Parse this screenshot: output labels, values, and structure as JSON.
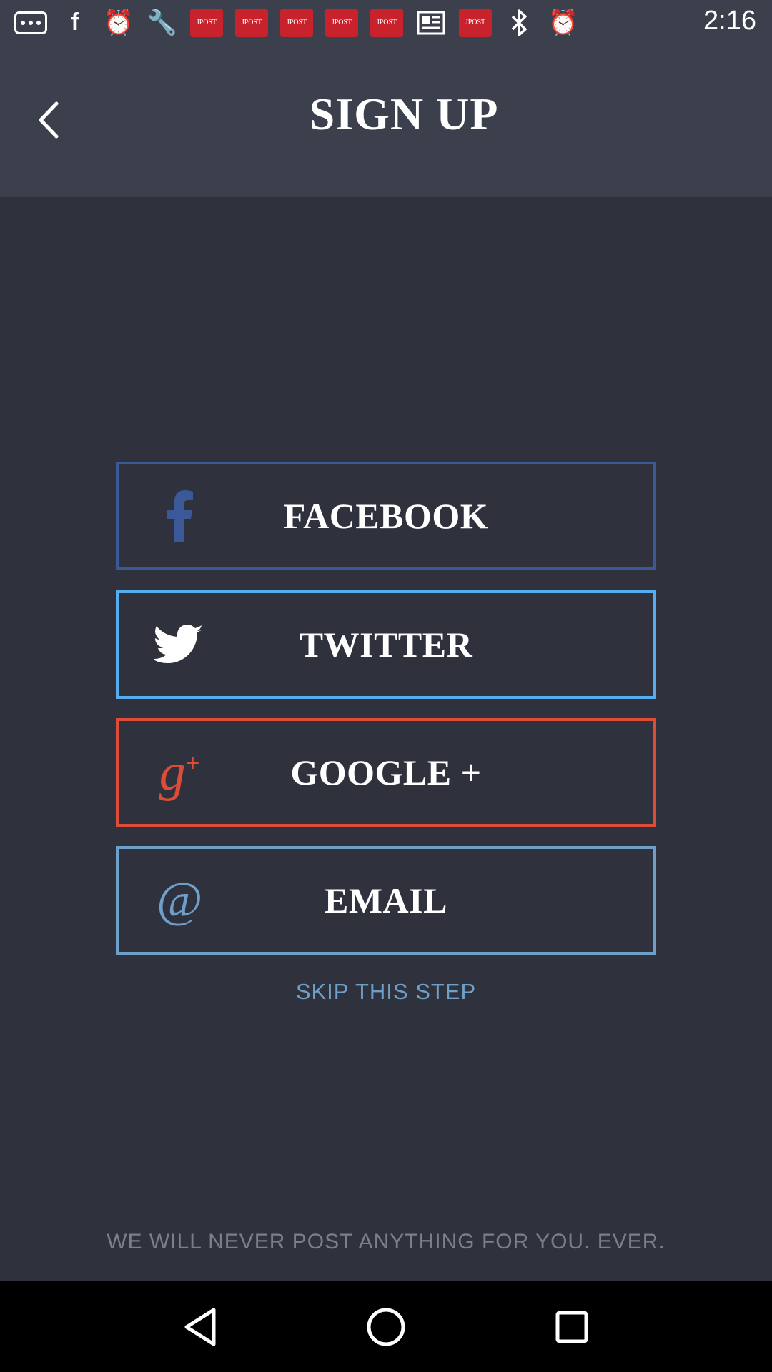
{
  "status_bar": {
    "time": "2:16",
    "jpost_badge": "JPOST",
    "icons": [
      "more-icon",
      "facebook-icon",
      "alarm-icon",
      "wrench-icon",
      "jpost-icon",
      "jpost-icon",
      "jpost-icon",
      "jpost-icon",
      "jpost-icon",
      "news-icon",
      "jpost-icon",
      "bluetooth-icon",
      "alarm-icon"
    ]
  },
  "header": {
    "title": "SIGN UP",
    "back_icon": "chevron-left-icon"
  },
  "buttons": [
    {
      "label": "FACEBOOK",
      "icon": "facebook-icon",
      "color": "#3b5998"
    },
    {
      "label": "TWITTER",
      "icon": "twitter-icon",
      "color": "#55acee"
    },
    {
      "label": "GOOGLE +",
      "icon": "google-plus-icon",
      "color": "#dd4b39"
    },
    {
      "label": "EMAIL",
      "icon": "at-icon",
      "color": "#6e9fc9"
    }
  ],
  "skip_label": "SKIP THIS STEP",
  "footer_note": "WE WILL NEVER POST ANYTHING FOR YOU. EVER.",
  "nav": [
    "back-triangle-icon",
    "home-circle-icon",
    "recents-square-icon"
  ]
}
